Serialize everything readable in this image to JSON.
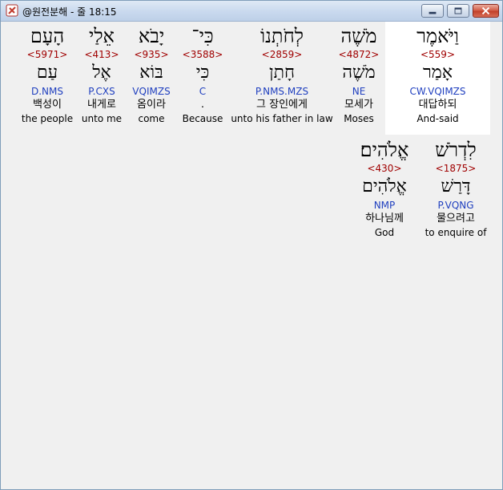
{
  "window": {
    "title": "@원전분해 - 줄 18:15"
  },
  "words": [
    {
      "hebrew": "וַיֹּאמֶר",
      "strong": "<559>",
      "lemma": "אָמַר",
      "morph": "CW.VQIMZS",
      "korean": "대답하되",
      "english": "And-said",
      "highlighted": true
    },
    {
      "hebrew": "מֹשֶׁה",
      "strong": "<4872>",
      "lemma": "מֹשֶׁה",
      "morph": "NE",
      "korean": "모세가",
      "english": "Moses",
      "highlighted": false
    },
    {
      "hebrew": "לְחֹתְנוֹ",
      "strong": "<2859>",
      "lemma": "חָתַן",
      "morph": "P.NMS.MZS",
      "korean": "그 장인에게",
      "english": "unto his father in law",
      "highlighted": false
    },
    {
      "hebrew": "כִּי־",
      "strong": "<3588>",
      "lemma": "כִּי",
      "morph": "C",
      "korean": ".",
      "english": "Because",
      "highlighted": false
    },
    {
      "hebrew": "יָבֹא",
      "strong": "<935>",
      "lemma": "בּוֹא",
      "morph": "VQIMZS",
      "korean": "옴이라",
      "english": "come",
      "highlighted": false
    },
    {
      "hebrew": "אֵלַי",
      "strong": "<413>",
      "lemma": "אֶל",
      "morph": "P.CXS",
      "korean": "내게로",
      "english": "unto me",
      "highlighted": false
    },
    {
      "hebrew": "הָעָם",
      "strong": "<5971>",
      "lemma": "עַם",
      "morph": "D.NMS",
      "korean": "백성이",
      "english": "the people",
      "highlighted": false
    },
    {
      "hebrew": "לִדְרֹשׁ",
      "strong": "<1875>",
      "lemma": "דָּרַשׁ",
      "morph": "P.VQNG",
      "korean": "물으려고",
      "english": "to enquire of",
      "highlighted": false
    },
    {
      "hebrew": "אֱלֹהִים׃",
      "strong": "<430>",
      "lemma": "אֱלֹהִים",
      "morph": "NMP",
      "korean": "하나님께",
      "english": "God",
      "highlighted": false
    }
  ]
}
